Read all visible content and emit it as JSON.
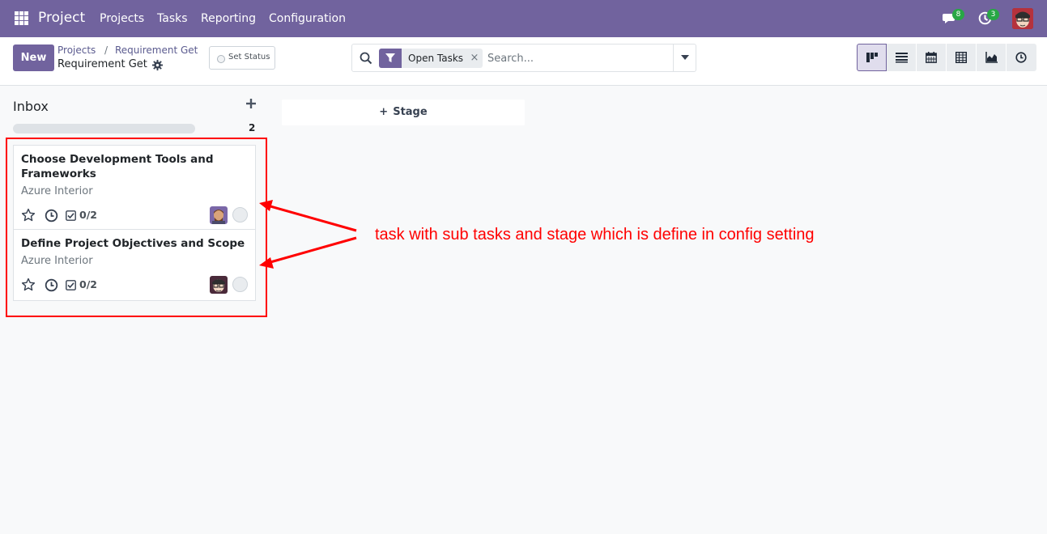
{
  "navbar": {
    "app_name": "Project",
    "menu": [
      "Projects",
      "Tasks",
      "Reporting",
      "Configuration"
    ],
    "messages_badge": "8",
    "activities_badge": "3",
    "bg_color": "#71639e"
  },
  "control": {
    "new_label": "New",
    "breadcrumb": [
      "Projects",
      "Requirement Get"
    ],
    "breadcrumb_sep": "/",
    "current": "Requirement Get",
    "set_status_label": "Set Status",
    "search": {
      "facet": "Open Tasks",
      "facet_close": "×",
      "placeholder": "Search..."
    },
    "views": [
      "kanban-icon",
      "list-icon",
      "calendar-icon",
      "pivot-icon",
      "graph-icon",
      "activity-icon"
    ]
  },
  "kanban": {
    "column": {
      "title": "Inbox",
      "count": "2",
      "cards": [
        {
          "title": "Choose Development Tools and Frameworks",
          "customer": "Azure Interior",
          "subtasks": "0/2"
        },
        {
          "title": "Define Project Objectives and Scope",
          "customer": "Azure Interior",
          "subtasks": "0/2"
        }
      ]
    },
    "add_stage_label": "Stage"
  },
  "annotation": {
    "text": "task with sub tasks and stage which is define in config setting",
    "color": "#ff0000"
  }
}
